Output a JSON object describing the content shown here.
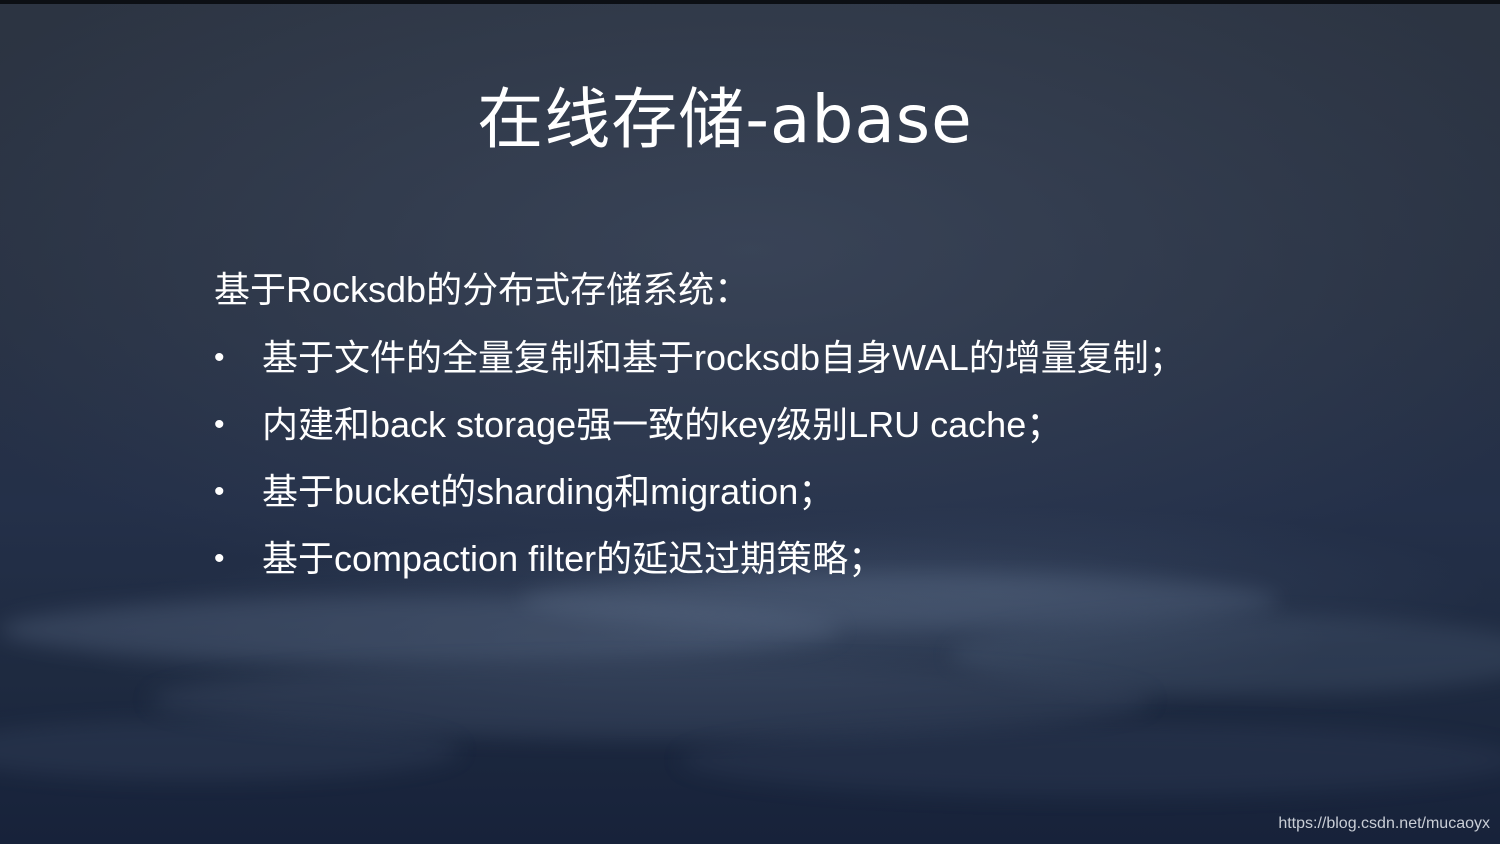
{
  "slide": {
    "title": "在线存储-abase",
    "intro": "基于Rocksdb的分布式存储系统：",
    "bullet_symbol": "•",
    "bullets": [
      "基于文件的全量复制和基于rocksdb自身WAL的增量复制；",
      "内建和back storage强一致的key级别LRU cache；",
      "基于bucket的sharding和migration；",
      "基于compaction filter的延迟过期策略；"
    ]
  },
  "watermark": "https://blog.csdn.net/mucaoyx",
  "colors": {
    "background_top": "#2c3442",
    "background_bottom": "#17223a",
    "text": "#ffffff"
  }
}
